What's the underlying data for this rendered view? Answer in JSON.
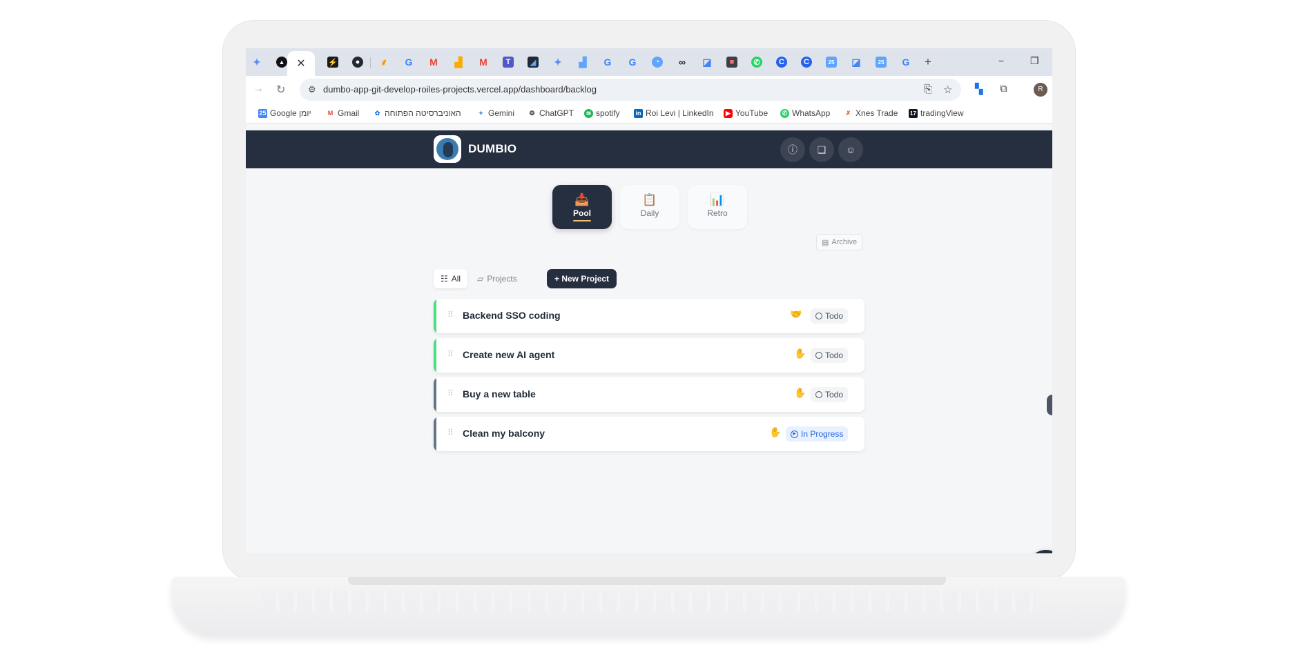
{
  "browser": {
    "tab_count": 28,
    "active_tab_close": "✕",
    "new_tab": "+",
    "minimize": "−",
    "restore": "❐",
    "url": "dumbo-app-git-develop-roiles-projects.vercel.app/dashboard/backlog",
    "profile_initial": "R"
  },
  "bookmarks": [
    {
      "label": "Google יומן",
      "icon": "calendar-icon",
      "color": "#4285f4"
    },
    {
      "label": "Gmail",
      "icon": "gmail-icon",
      "color": "#ea4335"
    },
    {
      "label": "האוניברסיטה הפתוחה",
      "icon": "openu-icon",
      "color": "#1a73e8"
    },
    {
      "label": "Gemini",
      "icon": "gemini-icon",
      "color": "#5b8def"
    },
    {
      "label": "ChatGPT",
      "icon": "chatgpt-icon",
      "color": "#555555"
    },
    {
      "label": "spotify",
      "icon": "spotify-icon",
      "color": "#1db954"
    },
    {
      "label": "Roi Levi | LinkedIn",
      "icon": "linkedin-icon",
      "color": "#0a66c2"
    },
    {
      "label": "YouTube",
      "icon": "youtube-icon",
      "color": "#ff0000"
    },
    {
      "label": "WhatsApp",
      "icon": "whatsapp-icon",
      "color": "#25d366"
    },
    {
      "label": "Xnes Trade",
      "icon": "xnes-icon",
      "color": "#e0662b"
    },
    {
      "label": "tradingView",
      "icon": "tradingview-icon",
      "color": "#131722"
    }
  ],
  "app": {
    "brand": "DUMBIO",
    "header_icons": [
      "info-icon",
      "book-icon",
      "user-icon"
    ],
    "views": [
      {
        "label": "Pool",
        "icon": "inbox-icon",
        "active": true
      },
      {
        "label": "Daily",
        "icon": "clipboard-icon",
        "active": false
      },
      {
        "label": "Retro",
        "icon": "bar-chart-icon",
        "active": false
      }
    ],
    "archive_label": "Archive",
    "filters": [
      {
        "label": "All",
        "icon": "grid-list-icon",
        "active": true
      },
      {
        "label": "Projects",
        "icon": "folder-icon",
        "active": false
      }
    ],
    "new_project_label": "+ New Project",
    "tasks": [
      {
        "title": "Backend SSO coding",
        "status": "Todo",
        "accent": "#4ade80",
        "icon": "handshake-icon"
      },
      {
        "title": "Create new AI agent",
        "status": "Todo",
        "accent": "#4ade80",
        "icon": "hand-icon"
      },
      {
        "title": "Buy a new table",
        "status": "Todo",
        "accent": "#64748b",
        "icon": "hand-icon"
      },
      {
        "title": "Clean my balcony",
        "status": "In Progress",
        "accent": "#64748b",
        "icon": "hand-icon"
      }
    ],
    "fab_label": "+"
  },
  "colors": {
    "header_bg": "#262f3f",
    "page_bg": "#f5f6f7",
    "accent_green": "#4ade80",
    "accent_slate": "#64748b",
    "in_progress_blue": "#2563eb"
  }
}
